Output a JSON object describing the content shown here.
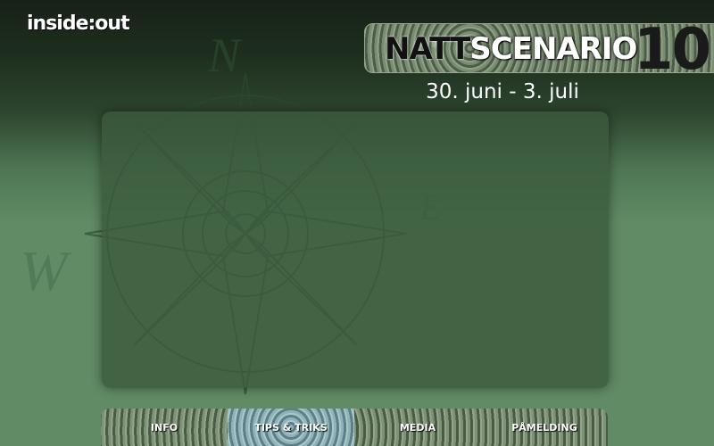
{
  "logo": "inside:out",
  "banner": {
    "part1": "NATT",
    "part2": "SCENARIO",
    "number": "10"
  },
  "dates": "30. juni - 3. juli",
  "compass": {
    "n": "N",
    "e": "E",
    "w": "W"
  },
  "nav": [
    {
      "label": "INFO",
      "active": false
    },
    {
      "label": "TIPS & TRIKS",
      "active": true
    },
    {
      "label": "MEDIA",
      "active": false
    },
    {
      "label": "PÅMELDING",
      "active": false
    }
  ]
}
